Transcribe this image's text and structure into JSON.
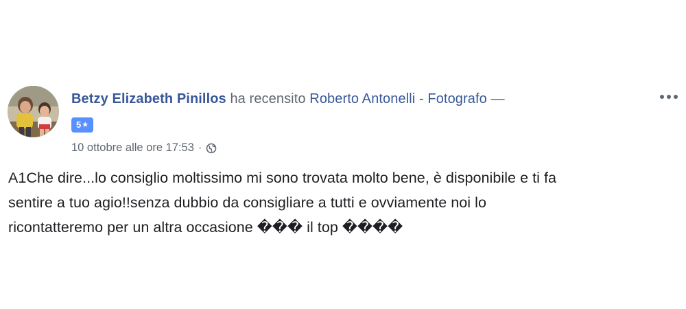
{
  "post": {
    "author_name": "Betzy Elizabeth Pinillos",
    "verb": "ha recensito",
    "page_name": "Roberto Antonelli - Fotografo",
    "dash": "—",
    "rating": {
      "value": "5",
      "star": "★"
    },
    "timestamp": "10 ottobre alle ore 17:53",
    "separator": "·",
    "privacy_icon": "globe-icon",
    "more_icon": "more-options-icon",
    "review_lines": [
      "A1Che dire...lo consiglio moltissimo mi sono trovata molto bene, è disponibile e ti fa",
      "sentire a tuo agio!!senza dubbio da consigliare a tutti e ovviamente noi lo",
      "ricontatteremo per un altra occasione ��� il top ����"
    ]
  },
  "colors": {
    "link_blue": "#385898",
    "secondary_gray": "#606770",
    "text_dark": "#1c1e21",
    "rating_blue": "#5890ff",
    "background": "#ffffff"
  }
}
